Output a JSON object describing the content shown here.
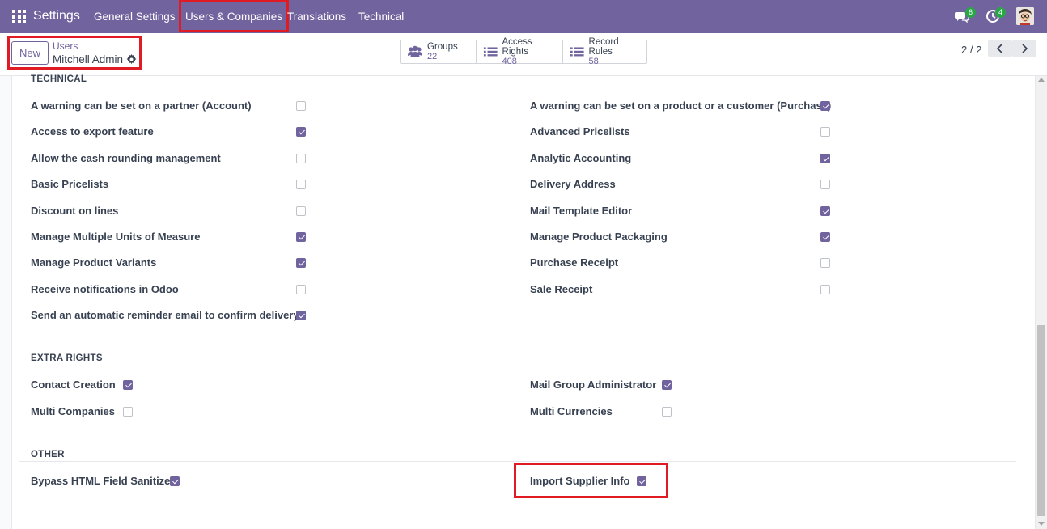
{
  "navbar": {
    "brand": "Settings",
    "menu": [
      "General Settings",
      "Users & Companies",
      "Translations",
      "Technical"
    ],
    "messages_count": "6",
    "activities_count": "4",
    "accent": "#71639e"
  },
  "control_panel": {
    "new_label": "New",
    "breadcrumb_parent": "Users",
    "breadcrumb_current": "Mitchell Admin",
    "smart_buttons": [
      {
        "label": "Groups",
        "value": "22",
        "icon": "users-icon"
      },
      {
        "label": "Access Rights",
        "value": "408",
        "icon": "list-icon"
      },
      {
        "label": "Record Rules",
        "value": "58",
        "icon": "list-icon"
      }
    ],
    "pager": "2 / 2"
  },
  "sections": {
    "technical": {
      "title": "TECHNICAL",
      "left": [
        {
          "label": "A warning can be set on a partner (Account)",
          "checked": false
        },
        {
          "label": "Access to export feature",
          "checked": true
        },
        {
          "label": "Allow the cash rounding management",
          "checked": false
        },
        {
          "label": "Basic Pricelists",
          "checked": false
        },
        {
          "label": "Discount on lines",
          "checked": false
        },
        {
          "label": "Manage Multiple Units of Measure",
          "checked": true
        },
        {
          "label": "Manage Product Variants",
          "checked": true
        },
        {
          "label": "Receive notifications in Odoo",
          "checked": false
        },
        {
          "label": "Send an automatic reminder email to confirm delivery",
          "checked": true
        }
      ],
      "right": [
        {
          "label": "A warning can be set on a product or a customer (Purchase)",
          "checked": true
        },
        {
          "label": "Advanced Pricelists",
          "checked": false
        },
        {
          "label": "Analytic Accounting",
          "checked": true
        },
        {
          "label": "Delivery Address",
          "checked": false
        },
        {
          "label": "Mail Template Editor",
          "checked": true
        },
        {
          "label": "Manage Product Packaging",
          "checked": true
        },
        {
          "label": "Purchase Receipt",
          "checked": false
        },
        {
          "label": "Sale Receipt",
          "checked": false
        }
      ]
    },
    "extra_rights": {
      "title": "EXTRA RIGHTS",
      "left": [
        {
          "label": "Contact Creation",
          "checked": true
        },
        {
          "label": "Multi Companies",
          "checked": false
        }
      ],
      "right": [
        {
          "label": "Mail Group Administrator",
          "checked": true
        },
        {
          "label": "Multi Currencies",
          "checked": false
        }
      ]
    },
    "other": {
      "title": "OTHER",
      "left": [
        {
          "label": "Bypass HTML Field Sanitize",
          "checked": true
        }
      ],
      "right": [
        {
          "label": "Import Supplier Info",
          "checked": true
        }
      ]
    }
  }
}
